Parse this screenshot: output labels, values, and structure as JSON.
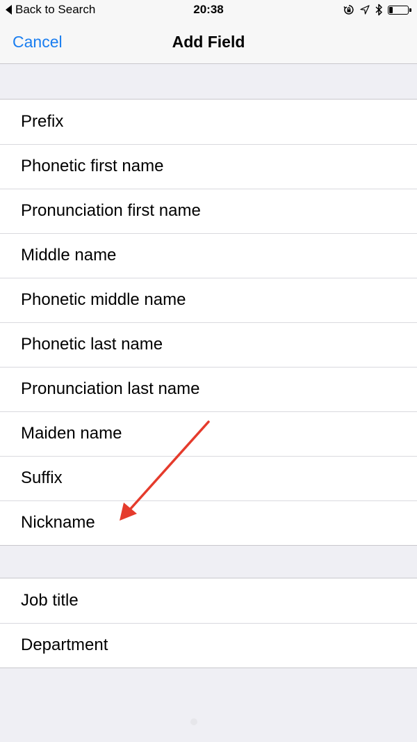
{
  "status_bar": {
    "back_label": "Back to Search",
    "time": "20:38",
    "battery_level": 0.2
  },
  "nav": {
    "cancel_label": "Cancel",
    "title": "Add Field"
  },
  "name_fields": [
    {
      "label": "Prefix"
    },
    {
      "label": "Phonetic first name"
    },
    {
      "label": "Pronunciation first name"
    },
    {
      "label": "Middle name"
    },
    {
      "label": "Phonetic middle name"
    },
    {
      "label": "Phonetic last name"
    },
    {
      "label": "Pronunciation last name"
    },
    {
      "label": "Maiden name"
    },
    {
      "label": "Suffix"
    },
    {
      "label": "Nickname"
    }
  ],
  "work_fields": [
    {
      "label": "Job title"
    },
    {
      "label": "Department"
    }
  ],
  "colors": {
    "accent": "#1a7ef0",
    "annotation_arrow": "#e53b2c",
    "background": "#efeff4"
  },
  "icons": [
    "back-triangle-icon",
    "rotation-lock-icon",
    "location-arrow-icon",
    "bluetooth-icon",
    "battery-icon",
    "annotation-arrow-icon"
  ]
}
